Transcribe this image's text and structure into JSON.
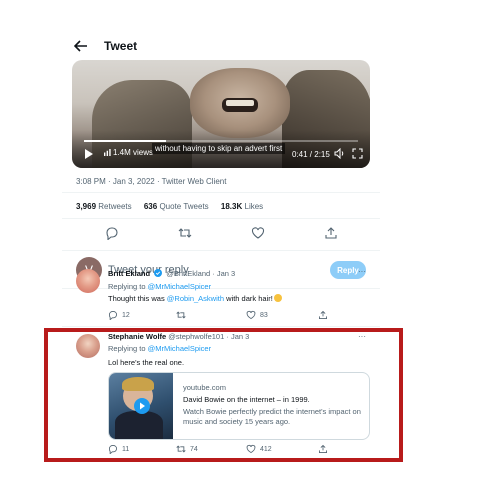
{
  "header": {
    "title": "Tweet"
  },
  "video": {
    "views": "1.4M views",
    "caption": "without having to skip an advert first",
    "time": "0:41 / 2:15",
    "progress": 0.3
  },
  "tweet_meta": "3:08 PM · Jan 3, 2022 · Twitter Web Client",
  "stats": [
    {
      "count": "3,969",
      "label": "Retweets"
    },
    {
      "count": "636",
      "label": "Quote Tweets"
    },
    {
      "count": "18.3K",
      "label": "Likes"
    }
  ],
  "reply_box": {
    "avatar_letter": "V",
    "placeholder": "Tweet your reply",
    "button": "Reply"
  },
  "replies": [
    {
      "name": "Britt Ekland",
      "handle": "@BrittEkland · Jan 3",
      "replying_prefix": "Replying to",
      "replying_to": "@MrMichaelSpicer",
      "text_before": "Thought this was",
      "text_mention": "@Robin_Askwith",
      "text_after": "with dark hair!",
      "reply_count": "12",
      "retweet_count": "",
      "like_count": "83"
    },
    {
      "name": "Stephanie Wolfe",
      "handle": "@stephwolfe101 · Jan 3",
      "replying_prefix": "Replying to",
      "replying_to": "@MrMichaelSpicer",
      "text": "Lol here's the real one.",
      "card": {
        "domain": "youtube.com",
        "title": "David Bowie on the internet – in 1999.",
        "description": "Watch Bowie perfectly predict the internet's impact on music and society 15 years ago."
      },
      "reply_count": "11",
      "retweet_count": "74",
      "like_count": "412"
    }
  ],
  "highlight_color": "#b81b1b",
  "accent_color": "#1d9bf0"
}
